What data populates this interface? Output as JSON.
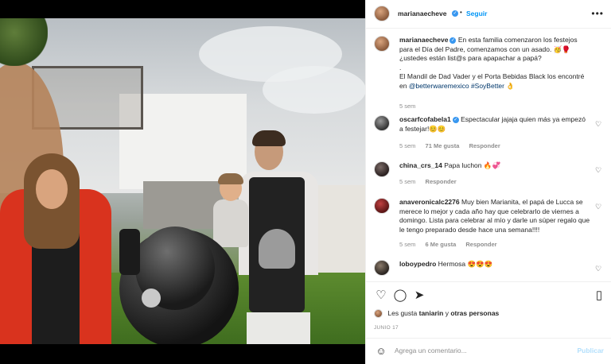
{
  "header": {
    "username": "marianaecheve",
    "follow_label": "Seguir",
    "more_icon": "more-horizontal-icon"
  },
  "caption": {
    "username": "marianaecheve",
    "line1": "En esta familia comenzaron los festejos para el Día del Padre, comenzamos con un asado. 🥳🥊 ¿ustedes están list@s para apapachar a papá?",
    "dot": ".",
    "line2": "El Mandil de Dad Vader y el Porta Bebidas Black los encontré en",
    "mention": "@betterwaremexico",
    "hashtag": "#SoyBetter",
    "emoji": "👌",
    "time": "5 sem"
  },
  "comments": [
    {
      "username": "oscarfcofabela1",
      "verified": true,
      "text": "Espectacular jajaja quien más ya empezó a festejar!😊😊",
      "time": "5 sem",
      "likes": "71 Me gusta",
      "reply": "Responder"
    },
    {
      "username": "china_crs_14",
      "verified": false,
      "text": "Papa luchon 🔥💞",
      "time": "5 sem",
      "likes": "",
      "reply": "Responder"
    },
    {
      "username": "anaveronicalc2276",
      "verified": false,
      "text": "Muy bien Marianita, el papá de Lucca se merece lo mejor y cada año hay que celebrarlo de viernes a domingo. Lista para celebrar al mío y darle un súper regalo que le tengo preparado desde hace una semana!!!!",
      "time": "5 sem",
      "likes": "6 Me gusta",
      "reply": "Responder"
    },
    {
      "username": "loboypedro",
      "verified": false,
      "text": "Hermosa 😍😍😍",
      "time": "",
      "likes": "",
      "reply": ""
    }
  ],
  "actions": {
    "like_icon": "heart-icon",
    "comment_icon": "comment-icon",
    "share_icon": "send-icon",
    "save_icon": "bookmark-icon"
  },
  "likes_text": {
    "prefix": "Les gusta",
    "user": "taniarin",
    "middle": "y",
    "others": "otras personas"
  },
  "date": "JUNIO 17",
  "add_comment": {
    "placeholder": "Agrega un comentario...",
    "post_label": "Publicar",
    "emoji_icon": "smiley-icon"
  }
}
